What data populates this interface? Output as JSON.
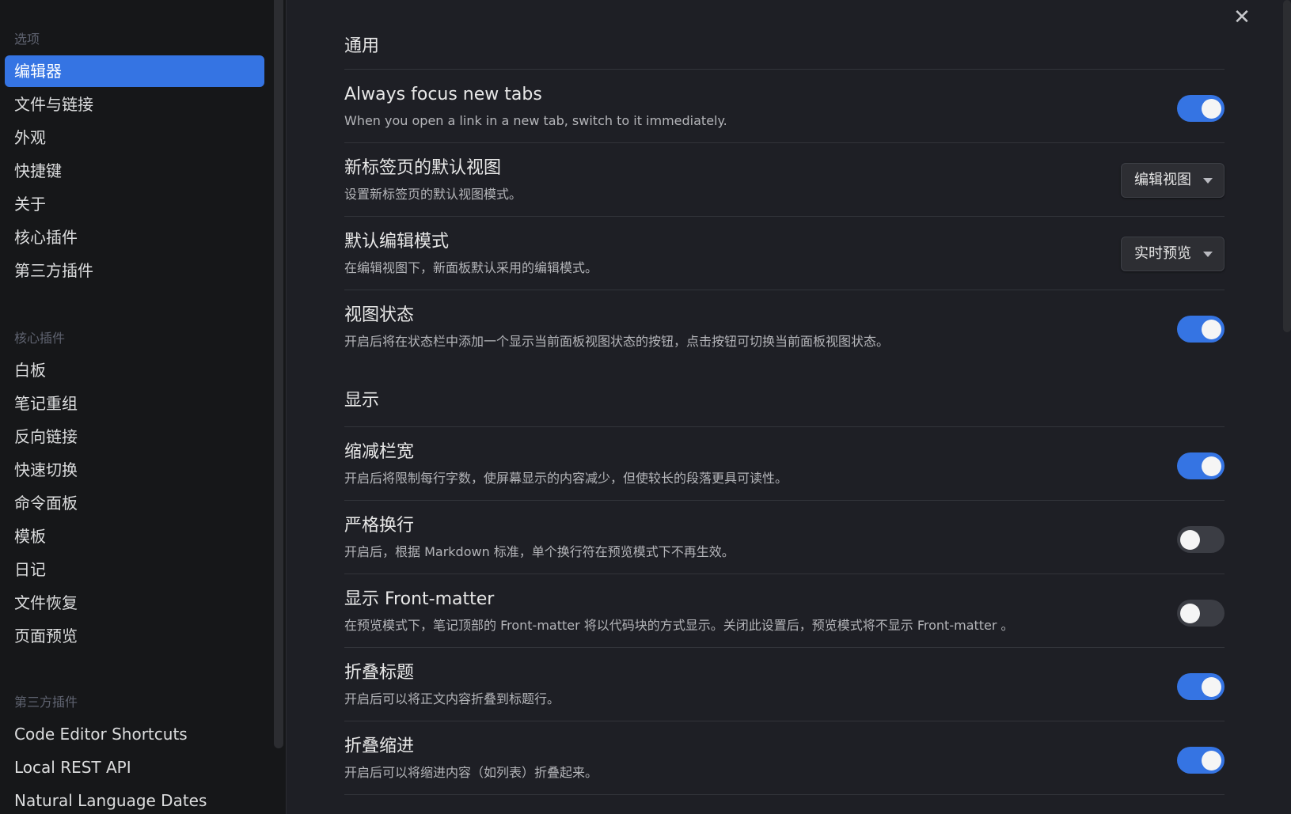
{
  "sidebar": {
    "options_title": "选项",
    "options": [
      {
        "label": "编辑器",
        "active": true
      },
      {
        "label": "文件与链接"
      },
      {
        "label": "外观"
      },
      {
        "label": "快捷键"
      },
      {
        "label": "关于"
      },
      {
        "label": "核心插件"
      },
      {
        "label": "第三方插件"
      }
    ],
    "core_title": "核心插件",
    "core": [
      {
        "label": "白板"
      },
      {
        "label": "笔记重组"
      },
      {
        "label": "反向链接"
      },
      {
        "label": "快速切换"
      },
      {
        "label": "命令面板"
      },
      {
        "label": "模板"
      },
      {
        "label": "日记"
      },
      {
        "label": "文件恢复"
      },
      {
        "label": "页面预览"
      }
    ],
    "community_title": "第三方插件",
    "community": [
      {
        "label": "Code Editor Shortcuts"
      },
      {
        "label": "Local REST API"
      },
      {
        "label": "Natural Language Dates"
      }
    ]
  },
  "close_icon": "close-icon",
  "sections": {
    "general_title": "通用",
    "display_title": "显示"
  },
  "settings": {
    "focus_tabs": {
      "name": "Always focus new tabs",
      "desc": "When you open a link in a new tab, switch to it immediately.",
      "enabled": true
    },
    "default_view": {
      "name": "新标签页的默认视图",
      "desc": "设置新标签页的默认视图模式。",
      "value": "编辑视图"
    },
    "edit_mode": {
      "name": "默认编辑模式",
      "desc": "在编辑视图下，新面板默认采用的编辑模式。",
      "value": "实时预览"
    },
    "view_state": {
      "name": "视图状态",
      "desc": "开启后将在状态栏中添加一个显示当前面板视图状态的按钮，点击按钮可切换当前面板视图状态。",
      "enabled": true
    },
    "readable_width": {
      "name": "缩减栏宽",
      "desc": "开启后将限制每行字数，使屏幕显示的内容减少，但使较长的段落更具可读性。",
      "enabled": true
    },
    "strict_breaks": {
      "name": "严格换行",
      "desc": "开启后，根据 Markdown 标准，单个换行符在预览模式下不再生效。",
      "enabled": false
    },
    "front_matter": {
      "name": "显示 Front-matter",
      "desc": "在预览模式下，笔记顶部的 Front-matter 将以代码块的方式显示。关闭此设置后，预览模式将不显示 Front-matter 。",
      "enabled": false
    },
    "fold_heading": {
      "name": "折叠标题",
      "desc": "开启后可以将正文内容折叠到标题行。",
      "enabled": true
    },
    "fold_indent": {
      "name": "折叠缩进",
      "desc": "开启后可以将缩进内容（如列表）折叠起来。",
      "enabled": true
    }
  },
  "colors": {
    "accent": "#3574e3",
    "background": "#1e1f25",
    "sidebar": "#161719"
  }
}
